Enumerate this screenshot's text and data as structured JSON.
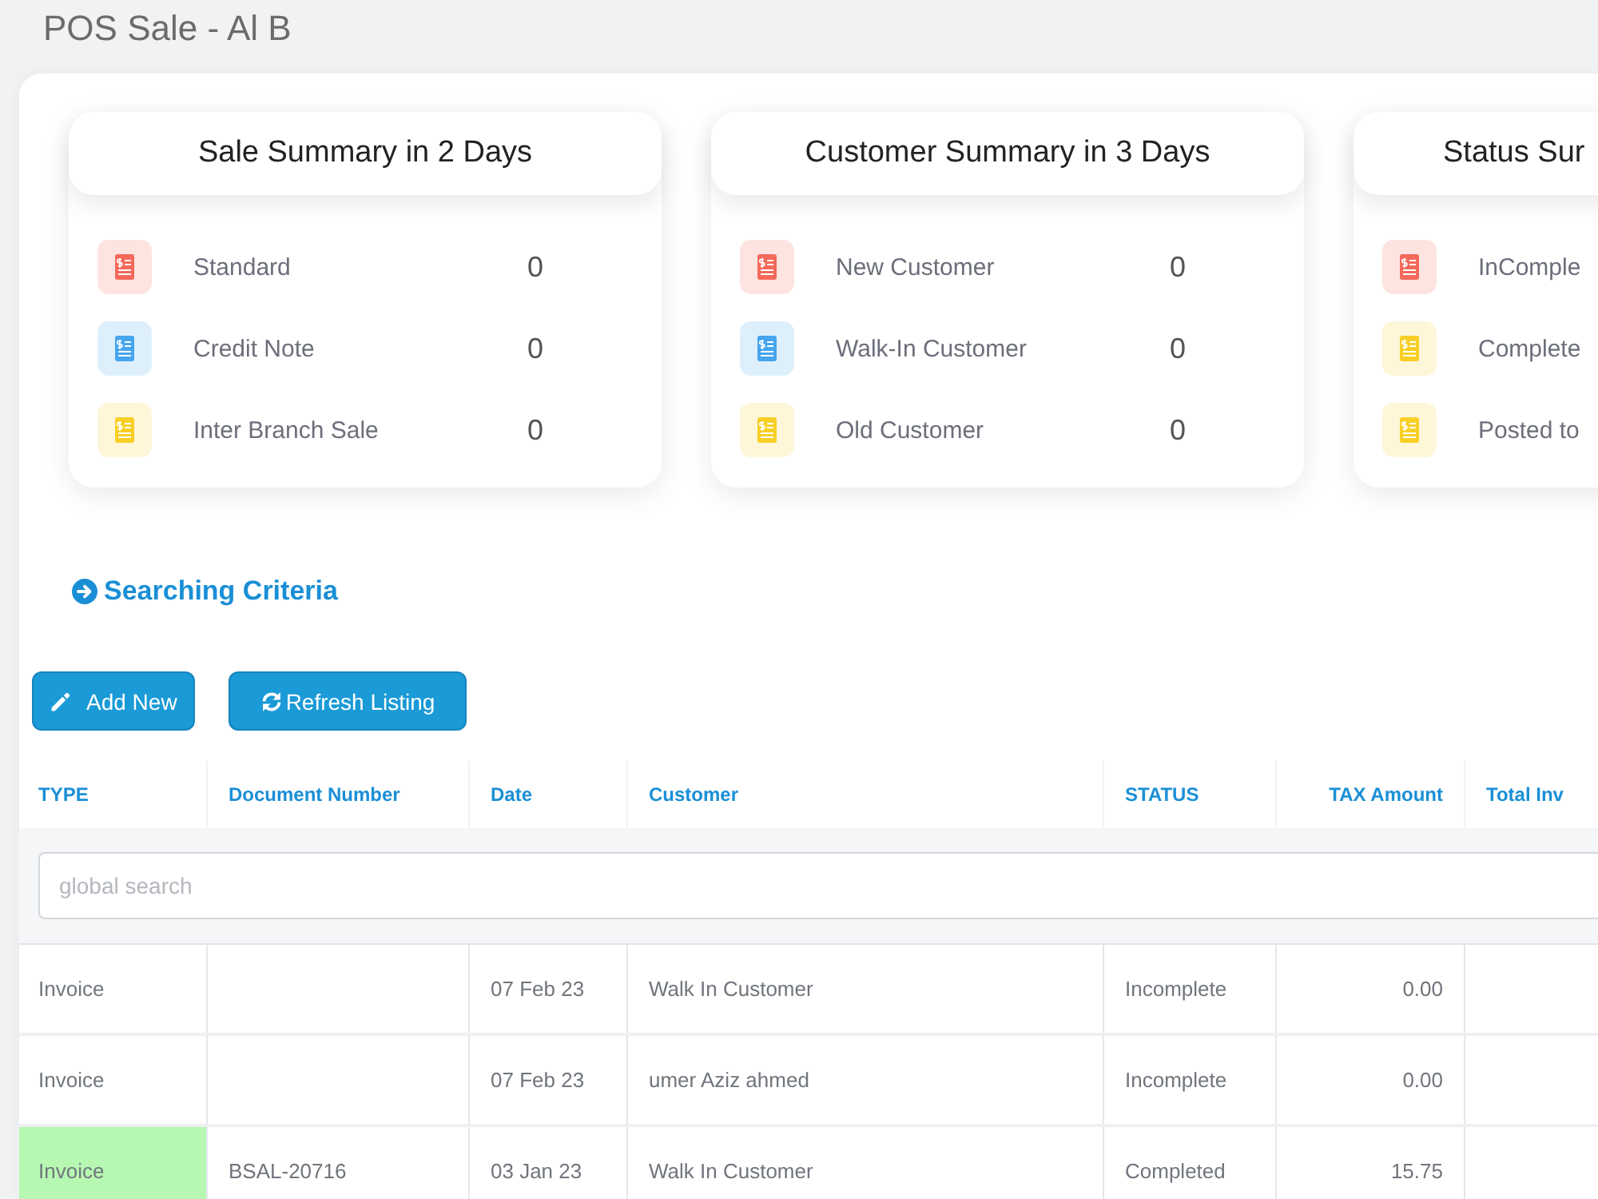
{
  "page": {
    "title": "POS Sale - Al B"
  },
  "summary_cards": [
    {
      "title": "Sale Summary in 2 Days",
      "items": [
        {
          "label": "Standard",
          "value": "0",
          "color": "#f4695a"
        },
        {
          "label": "Credit Note",
          "value": "0",
          "color": "#45a5ee"
        },
        {
          "label": "Inter Branch Sale",
          "value": "0",
          "color": "#f8cf26"
        }
      ]
    },
    {
      "title": "Customer Summary in 3 Days",
      "items": [
        {
          "label": "New Customer",
          "value": "0",
          "color": "#f4695a"
        },
        {
          "label": "Walk-In Customer",
          "value": "0",
          "color": "#45a5ee"
        },
        {
          "label": "Old Customer",
          "value": "0",
          "color": "#f8cf26"
        }
      ]
    },
    {
      "title": "Status Sur",
      "items": [
        {
          "label": "InComple",
          "color": "#f4695a"
        },
        {
          "label": "Complete",
          "color": "#f8cf26"
        },
        {
          "label": "Posted to",
          "color": "#f8cf26"
        }
      ]
    }
  ],
  "search_criteria": {
    "label": "Searching Criteria"
  },
  "buttons": [
    {
      "label": "Add New",
      "kind": "add"
    },
    {
      "label": "Refresh Listing",
      "kind": "refresh"
    }
  ],
  "table": {
    "columns": [
      {
        "label": "TYPE"
      },
      {
        "label": "Document Number"
      },
      {
        "label": "Date"
      },
      {
        "label": "Customer"
      },
      {
        "label": "STATUS"
      },
      {
        "label": "TAX Amount"
      },
      {
        "label": "Total Inv"
      }
    ],
    "search": {
      "placeholder": "global search"
    },
    "rows": [
      {
        "type": "Invoice",
        "date": "07 Feb 23",
        "customer": "Walk In Customer",
        "status": "Incomplete",
        "tax_amount": "0.00",
        "highlighted": false
      },
      {
        "type": "Invoice",
        "date": "07 Feb 23",
        "customer": "umer Aziz ahmed",
        "status": "Incomplete",
        "tax_amount": "0.00",
        "highlighted": false
      },
      {
        "type": "Invoice",
        "document_number": "BSAL-20716",
        "date": "03 Jan 23",
        "customer": "Walk In Customer",
        "status": "Completed",
        "tax_amount": "15.75",
        "highlighted": true
      }
    ]
  }
}
